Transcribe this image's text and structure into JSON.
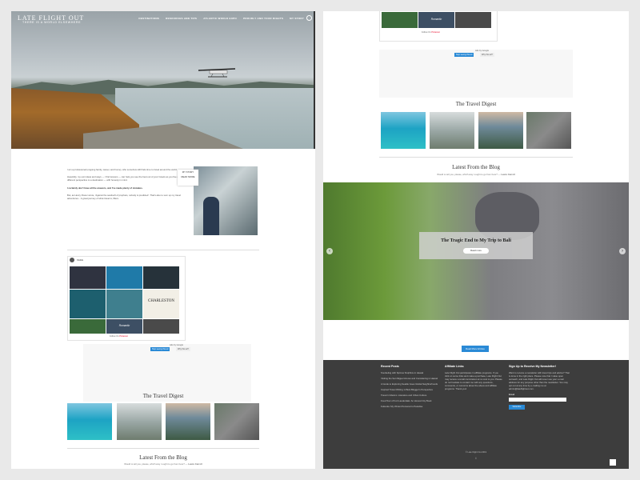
{
  "site": {
    "logo": "LATE FLIGHT OUT",
    "tagline": "THERE IS A WORLD ELSEWHERE",
    "nav": [
      "DESTINATIONS",
      "RESOURCES AND TIPS",
      "ATLANTIC WORLD EXPO",
      "PROUDLY AND YOUR RIGHTS",
      "MY STORY"
    ]
  },
  "about": {
    "paragraphs": [
      "I am a professional (ongoing family, career, and home), who somehow still finds time to travel around the world.",
      "Hopefully, my own ideas and ways — I find lessons — can help you see the best out of your travels as you live a different perspective to a destination — with honesty in mind.",
      "I certainly don't have all the answers, and I've made plenty of mistakes.",
      "But, as Henry Power wrote, 'Against the sandsoft of prophets, nobody is predicted'. That's also to sum up my travel adventures... A great journey of what travel is, fillers."
    ],
    "story_btn": [
      "MY STORY",
      "READ MORE"
    ]
  },
  "pinterest": {
    "handle": "frlsfsfs",
    "follow": "Follow On",
    "brand": "Pinterest",
    "tile_texts": [
      "CHARLESTON",
      "ROMANTIC THINGS TO DO IN CHARLESTON",
      "Romantic"
    ]
  },
  "ad": {
    "label": "Ads by Google",
    "btn1": "Stop seeing this ad",
    "btn2": "Why this ad?"
  },
  "digest": {
    "title": "The Travel Digest"
  },
  "latest": {
    "title": "Latest From the Blog",
    "quote": "Would to tell you, please, which way I ought to go from here?",
    "quote_author": "Lewis Carroll"
  },
  "slider": {
    "title": "The Tragic End to My Trip to Bali",
    "readmore": "Read more",
    "prev": "‹",
    "next": "›"
  },
  "read_all": "Read More Articles",
  "footer": {
    "recent_head": "Recent Posts",
    "recent": [
      "Snorkeling with Spinner Dolphins in Hawaii",
      "Visiting the San Miguel Azores and Considering in Hawaii",
      "A Guide to Exploring Seattle Goes Global Neighborhoods",
      "Inspired Travel Writing: A Best Blogger's Perspective",
      "Travel in Mexico: Literature and Urban Culture",
      "Food Tour of Fort Lauderdale: An Honest City Book",
      "Fukuoka: My Vibrant Personal to Paradise"
    ],
    "affiliate_head": "Affiliate Links",
    "affiliate_text": "Late Flight Out participates in affiliate programs. If you click on some links and make a purchase, Late Flight Out may receive a small commission at no cost to you. Please do not hesitate to contact me with any questions, comments, or concerns about the above and affiliate programs. Thank you!",
    "newsletter_head": "Sign Up to Receive My Newsletter!",
    "newsletter_text": "Want to receive a newsletter with travel tips and advice? That is done in the right place. Please note that I value open outreach, and Late Flight Out will never use your e-mail address for any purpose other than the newsletter. You may opt out at any time by e-mailing me at admin@lateflightout.com.",
    "email_label": "Email",
    "subscribe": "Subscribe",
    "copyright": "© Late Flight Out 2019",
    "copyright2": "©"
  }
}
